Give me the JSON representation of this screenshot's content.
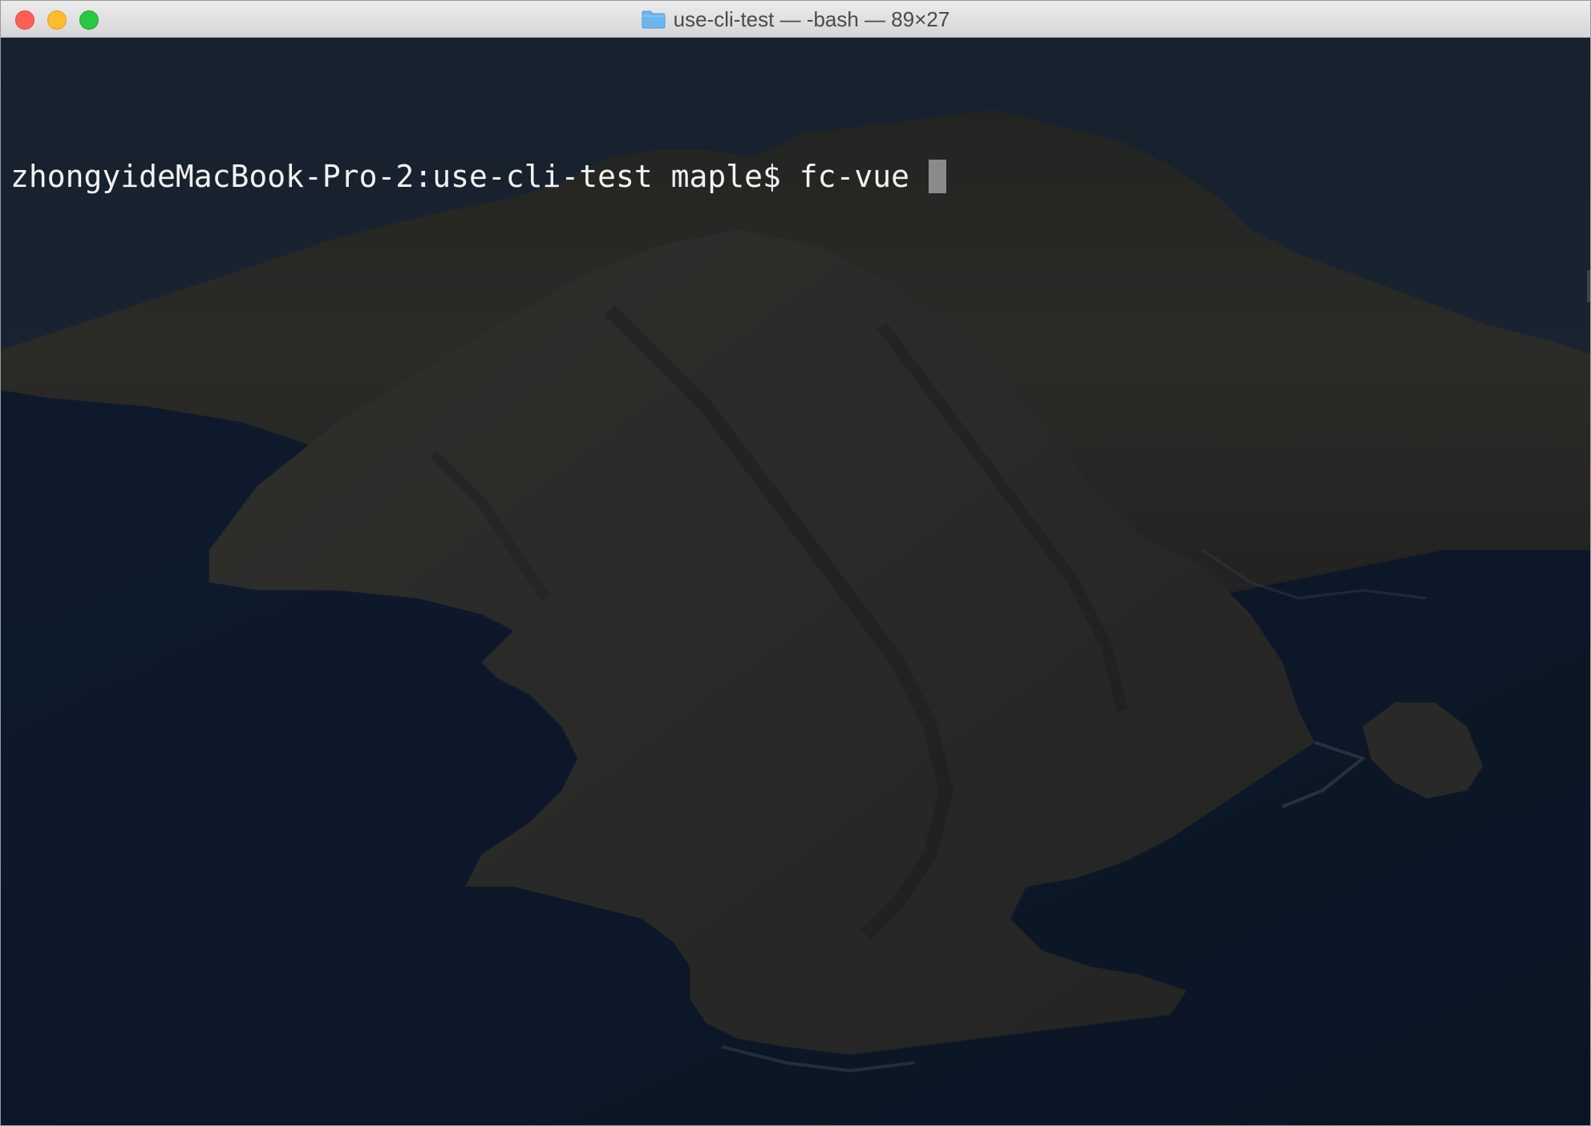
{
  "window": {
    "title": "use-cli-test — -bash — 89×27",
    "folder_icon": "folder-icon",
    "controls": {
      "close": "close-button",
      "minimize": "minimize-button",
      "zoom": "zoom-button"
    }
  },
  "terminal": {
    "prompt": "zhongyideMacBook-Pro-2:use-cli-test maple$ ",
    "command": "fc-vue"
  },
  "colors": {
    "close": "#fd5f57",
    "minimize": "#febc2e",
    "zoom": "#28c840",
    "terminal_text": "#f2f2f2",
    "cursor": "#8a8a8a"
  }
}
